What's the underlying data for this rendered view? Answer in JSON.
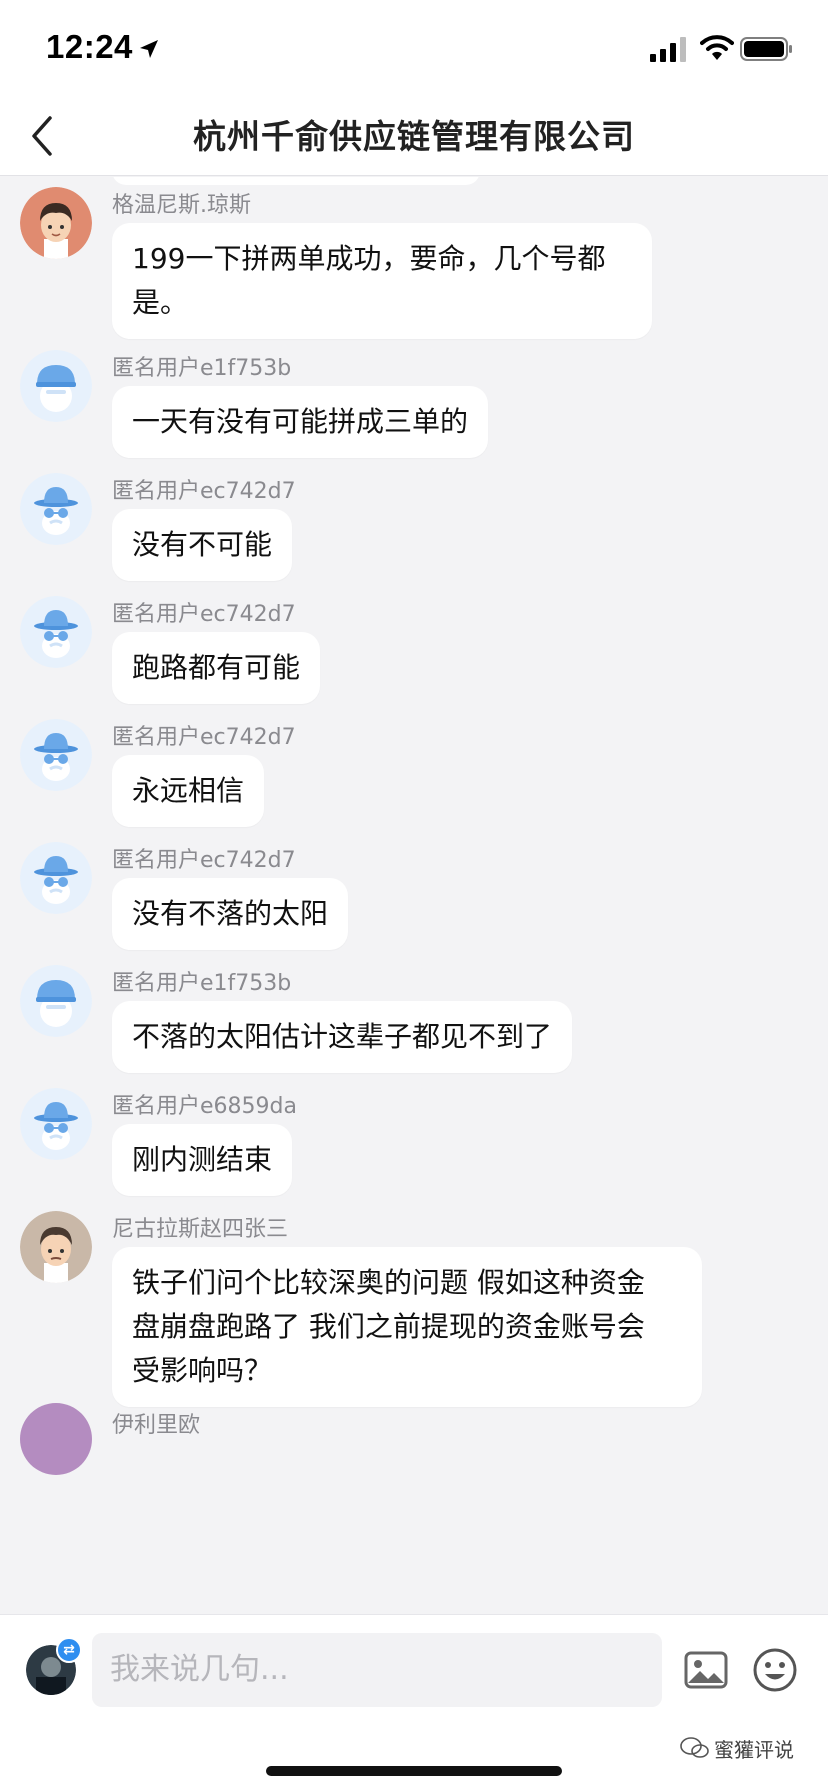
{
  "status_bar": {
    "time": "12:24"
  },
  "nav": {
    "title": "杭州千俞供应链管理有限公司"
  },
  "messages": [
    {
      "name": "格温尼斯.琼斯",
      "avatar": "male-cartoon-avatar",
      "lines": [
        "199一下拼两单成功，要命，几个号都",
        "是。"
      ]
    },
    {
      "name": "匿名用户e1f753b",
      "avatar": "anonymous-cap-avatar",
      "lines": [
        "一天有没有可能拼成三单的"
      ]
    },
    {
      "name": "匿名用户ec742d7",
      "avatar": "anonymous-hat-avatar",
      "lines": [
        "没有不可能"
      ]
    },
    {
      "name": "匿名用户ec742d7",
      "avatar": "anonymous-hat-avatar",
      "lines": [
        "跑路都有可能"
      ]
    },
    {
      "name": "匿名用户ec742d7",
      "avatar": "anonymous-hat-avatar",
      "lines": [
        "永远相信"
      ]
    },
    {
      "name": "匿名用户ec742d7",
      "avatar": "anonymous-hat-avatar",
      "lines": [
        "没有不落的太阳"
      ]
    },
    {
      "name": "匿名用户e1f753b",
      "avatar": "anonymous-cap-avatar",
      "lines": [
        "不落的太阳估计这辈子都见不到了"
      ]
    },
    {
      "name": "匿名用户e6859da",
      "avatar": "anonymous-hat-avatar",
      "lines": [
        "刚内测结束"
      ]
    },
    {
      "name": "尼古拉斯赵四张三",
      "avatar": "male-cartoon-avatar",
      "lines": [
        "铁子们问个比较深奥的问题 假如这种资金",
        "盘崩盘跑路了 我们之前提现的资金账号会",
        "受影响吗？"
      ]
    }
  ],
  "partial_message": {
    "name": "伊利里欧"
  },
  "input_bar": {
    "placeholder": "我来说几句..."
  },
  "watermark": {
    "text": "蜜獾评说"
  },
  "colors": {
    "background": "#f3f3f5",
    "bubble": "#ffffff",
    "username": "#8a8a8f",
    "anonymous_avatar": "#6aa8e8"
  }
}
